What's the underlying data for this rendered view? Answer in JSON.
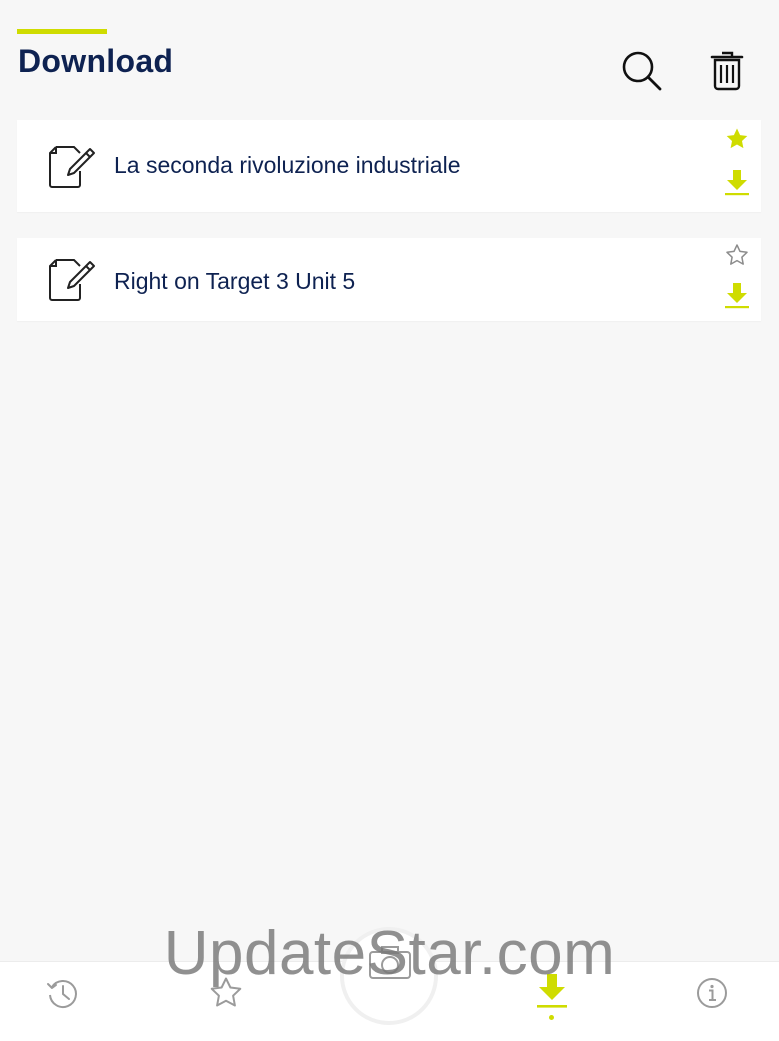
{
  "header": {
    "title": "Download",
    "search_icon": "search-icon",
    "trash_icon": "trash-icon"
  },
  "items": [
    {
      "title": "La seconda rivoluzione industriale",
      "icon": "document-edit-icon",
      "favorite": true,
      "downloaded": true
    },
    {
      "title": "Right on Target 3 Unit 5",
      "icon": "document-edit-icon",
      "favorite": false,
      "downloaded": true
    }
  ],
  "bottom_nav": {
    "items": [
      {
        "name": "history",
        "icon": "history-clock-icon",
        "active": false
      },
      {
        "name": "favorites",
        "icon": "star-icon",
        "active": false
      },
      {
        "name": "camera",
        "icon": "camera-icon",
        "active": false
      },
      {
        "name": "download",
        "icon": "download-icon",
        "active": true
      },
      {
        "name": "info",
        "icon": "info-icon",
        "active": false
      }
    ]
  },
  "watermark": "UpdateStar.com",
  "colors": {
    "accent": "#cfdc00",
    "navy": "#0e2251",
    "background": "#f7f7f7",
    "card": "#ffffff",
    "inactive_icon": "#9b9b9b"
  }
}
